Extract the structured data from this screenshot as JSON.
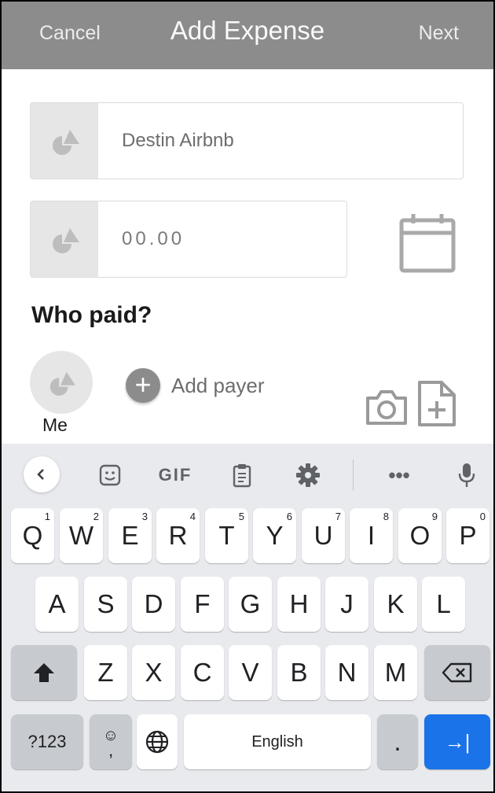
{
  "header": {
    "cancel_label": "Cancel",
    "title": "Add Expense",
    "next_label": "Next"
  },
  "form": {
    "description_value": "Destin Airbnb",
    "amount_placeholder": "00.00",
    "who_paid_label": "Who paid?",
    "payer_name": "Me",
    "add_payer_label": "Add payer"
  },
  "keyboard": {
    "toolbar": {
      "gif_label": "GIF",
      "more_label": "•••"
    },
    "row1": [
      {
        "key": "Q",
        "hint": "1"
      },
      {
        "key": "W",
        "hint": "2"
      },
      {
        "key": "E",
        "hint": "3"
      },
      {
        "key": "R",
        "hint": "4"
      },
      {
        "key": "T",
        "hint": "5"
      },
      {
        "key": "Y",
        "hint": "6"
      },
      {
        "key": "U",
        "hint": "7"
      },
      {
        "key": "I",
        "hint": "8"
      },
      {
        "key": "O",
        "hint": "9"
      },
      {
        "key": "P",
        "hint": "0"
      }
    ],
    "row2": [
      "A",
      "S",
      "D",
      "F",
      "G",
      "H",
      "J",
      "K",
      "L"
    ],
    "row3": [
      "Z",
      "X",
      "C",
      "V",
      "B",
      "N",
      "M"
    ],
    "symbols_label": "?123",
    "emoji_glyph": "☺",
    "comma_label": ",",
    "space_label": "English",
    "period_label": ".",
    "enter_glyph": "→|",
    "accent_color": "#1a73e8"
  },
  "colors": {
    "header_bg": "#8c8c8c",
    "keyboard_bg": "#e8eaed"
  }
}
